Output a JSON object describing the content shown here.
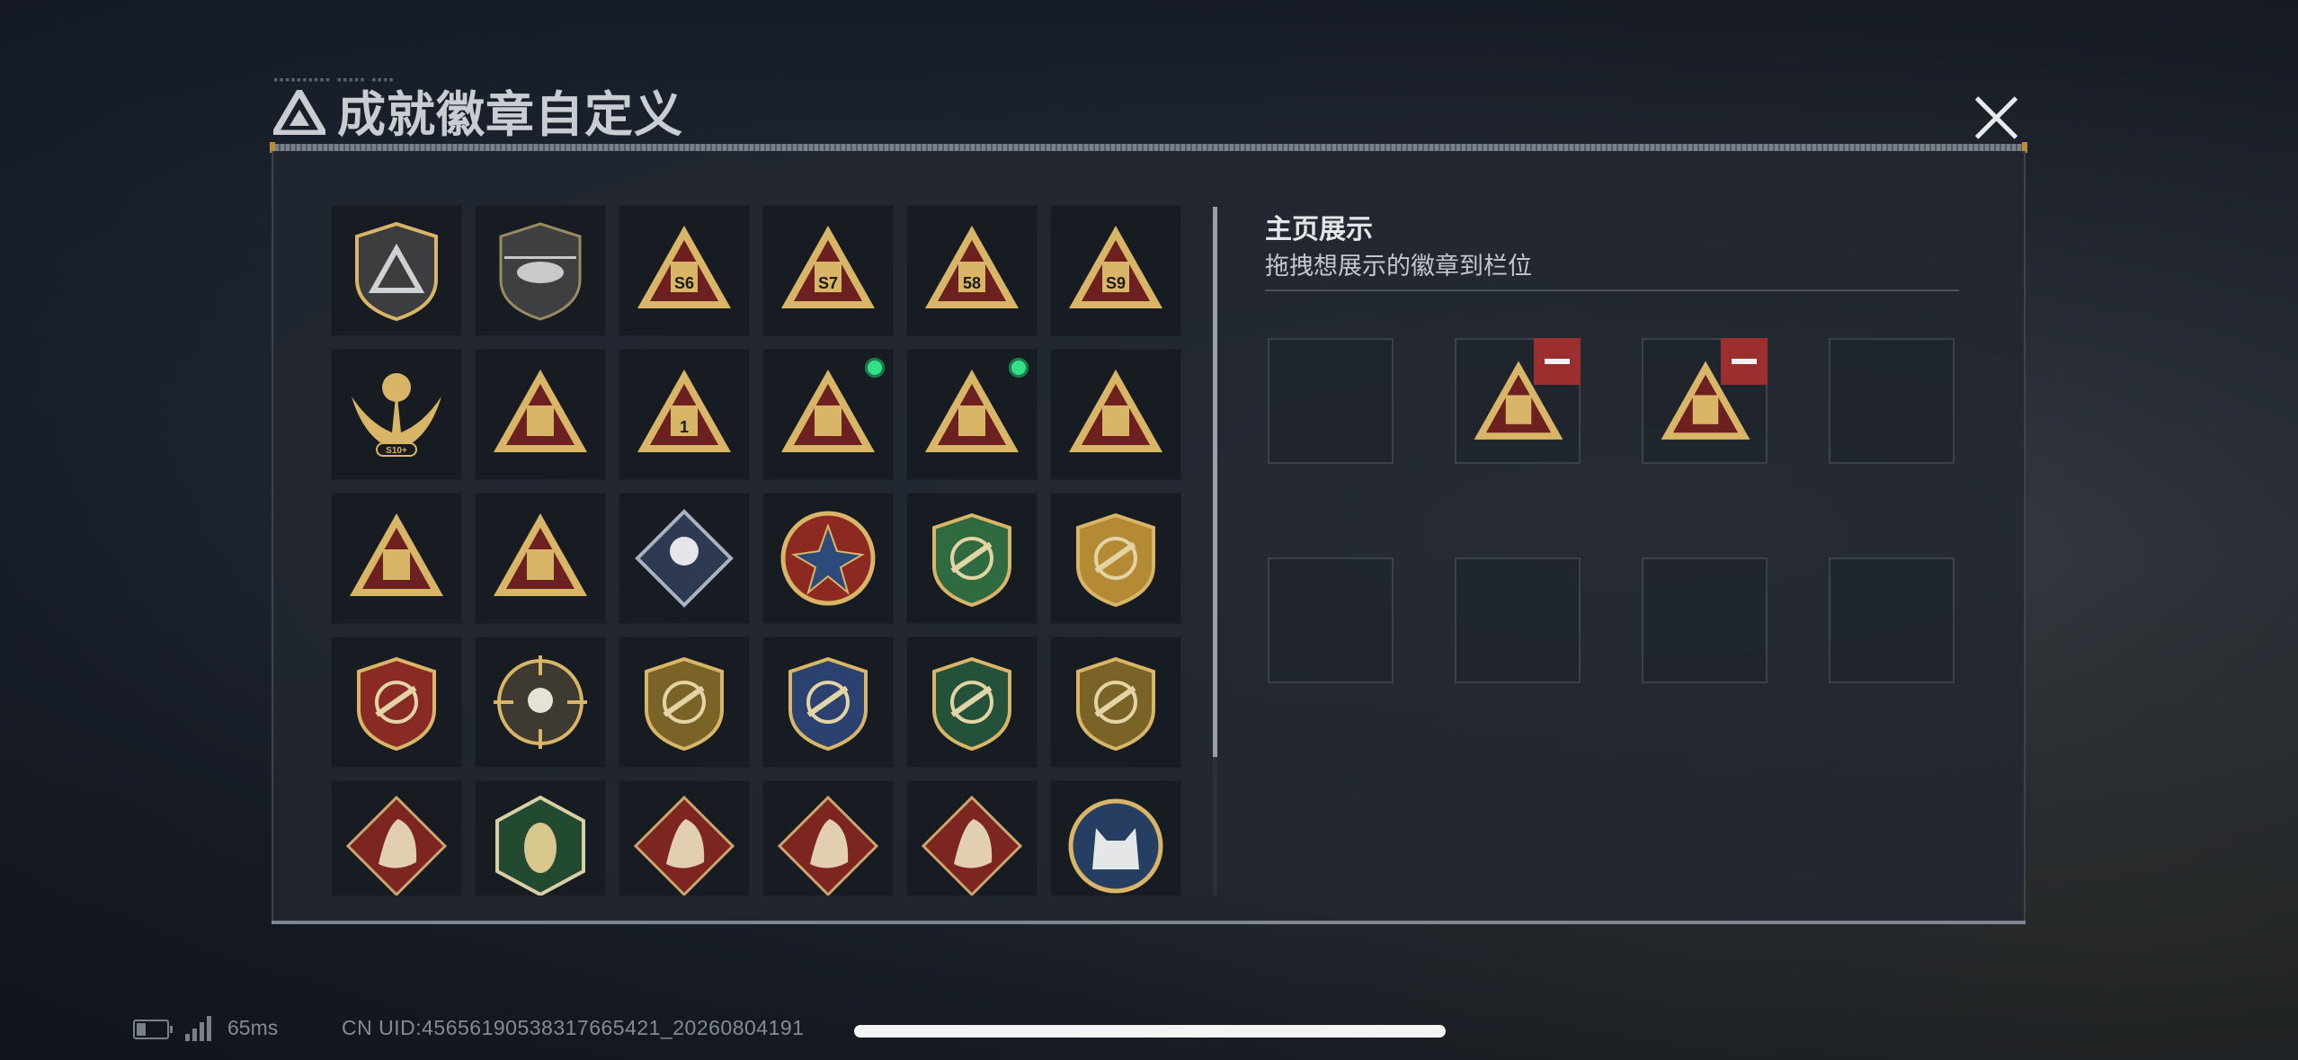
{
  "header": {
    "title": "成就徽章自定义",
    "close_icon": "close-icon",
    "logo_icon": "triangle-logo-icon"
  },
  "colors": {
    "gold": "#d8b567",
    "dark_red": "#6e1f1f",
    "green_dot": "#35e08a",
    "remove_red": "#9b2e2e"
  },
  "badges": [
    {
      "name": "triangle-shield-badge",
      "type": "shield-tri"
    },
    {
      "name": "helicopter-badge",
      "type": "heli"
    },
    {
      "name": "s6-season-badge",
      "type": "tri",
      "label": "S6"
    },
    {
      "name": "s7-season-badge",
      "type": "tri",
      "label": "S7"
    },
    {
      "name": "s8-season-badge",
      "type": "tri",
      "label": "58"
    },
    {
      "name": "s9-season-badge",
      "type": "tri",
      "label": "S9"
    },
    {
      "name": "s10-season-badge",
      "type": "eagle",
      "label": "S10+"
    },
    {
      "name": "bird-tri-badge",
      "type": "tri"
    },
    {
      "name": "number-one-badge",
      "type": "tri",
      "label": "1"
    },
    {
      "name": "usb-tri-badge",
      "type": "tri",
      "new": true
    },
    {
      "name": "mask-tri-badge",
      "type": "tri",
      "new": true
    },
    {
      "name": "hands-tri-badge",
      "type": "tri"
    },
    {
      "name": "squad-tri-badge",
      "type": "tri"
    },
    {
      "name": "beast-tri-badge",
      "type": "tri"
    },
    {
      "name": "rose-diamond-badge",
      "type": "diamond"
    },
    {
      "name": "star-round-badge",
      "type": "round-red"
    },
    {
      "name": "green-shield-badge",
      "type": "shield-green"
    },
    {
      "name": "gold-emblem-badge",
      "type": "shield-gold"
    },
    {
      "name": "red-gem-emblem-badge",
      "type": "shield-red"
    },
    {
      "name": "skull-crosshair-badge",
      "type": "crosshair"
    },
    {
      "name": "gold-rifle-shield-badge",
      "type": "shield-rifle-gold"
    },
    {
      "name": "blue-rifle-shield-badge",
      "type": "shield-rifle-blue"
    },
    {
      "name": "green-rifle-shield-badge",
      "type": "shield-rifle-green"
    },
    {
      "name": "gold-rifle-shield-2-badge",
      "type": "shield-rifle-gold"
    },
    {
      "name": "wolf-diamond-badge",
      "type": "diamond-red"
    },
    {
      "name": "bee-hex-badge",
      "type": "hex-green"
    },
    {
      "name": "dragon-diamond-badge",
      "type": "diamond-red"
    },
    {
      "name": "dragon-diamond-2-badge",
      "type": "diamond-red"
    },
    {
      "name": "runner-diamond-badge",
      "type": "diamond-red"
    },
    {
      "name": "lynx-round-badge",
      "type": "round-blue"
    }
  ],
  "showcase": {
    "title": "主页展示",
    "subtitle": "拖拽想展示的徽章到栏位",
    "slots": [
      {
        "filled": false
      },
      {
        "filled": true,
        "badge": "mask-tri-badge"
      },
      {
        "filled": true,
        "badge": "usb-tri-badge"
      },
      {
        "filled": false
      },
      {
        "filled": false
      },
      {
        "filled": false
      },
      {
        "filled": false
      },
      {
        "filled": false
      }
    ]
  },
  "status": {
    "ping": "65ms",
    "uid": "CN UID:45656190538317665421_20260804191"
  }
}
